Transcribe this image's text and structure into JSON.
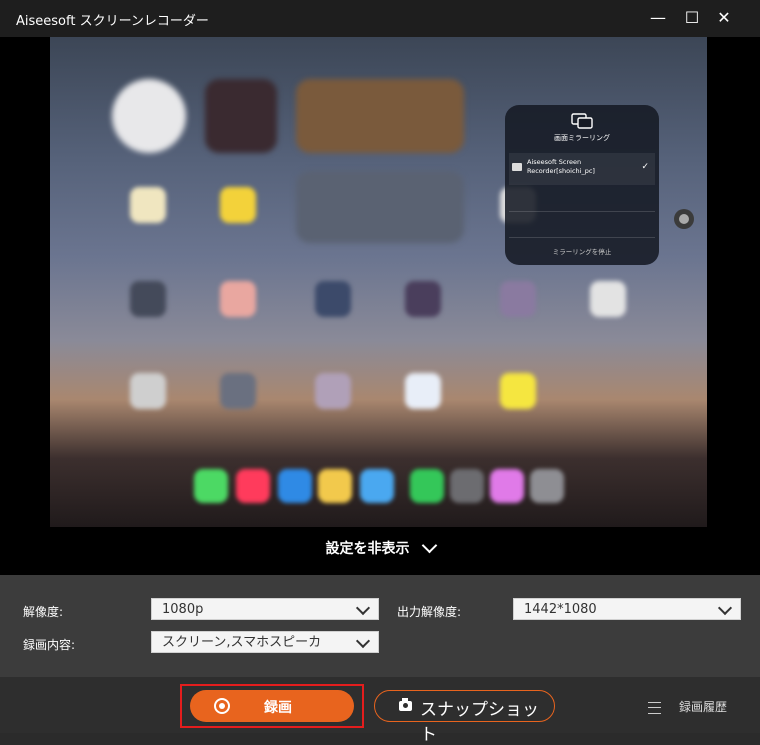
{
  "window": {
    "title": "Aiseesoft スクリーンレコーダー",
    "minimize": "—",
    "maximize": "☐",
    "close": "✕"
  },
  "preview": {
    "panel_title": "画面ミラーリング",
    "device_name": "Aiseesoft Screen Recorder[shoichi_pc]",
    "check": "✓",
    "stop_label": "ミラーリングを停止"
  },
  "toggle": {
    "label": "設定を非表示"
  },
  "settings": {
    "resolution_label": "解像度:",
    "resolution_value": "1080p",
    "output_resolution_label": "出力解像度:",
    "output_resolution_value": "1442*1080",
    "content_label": "録画内容:",
    "content_value": "スクリーン,スマホスピーカ"
  },
  "actions": {
    "record_label": "録画",
    "snapshot_label": "スナップショット",
    "history_label": "録画履歴"
  },
  "colors": {
    "accent": "#e8641e",
    "highlight": "#e41d1d"
  }
}
